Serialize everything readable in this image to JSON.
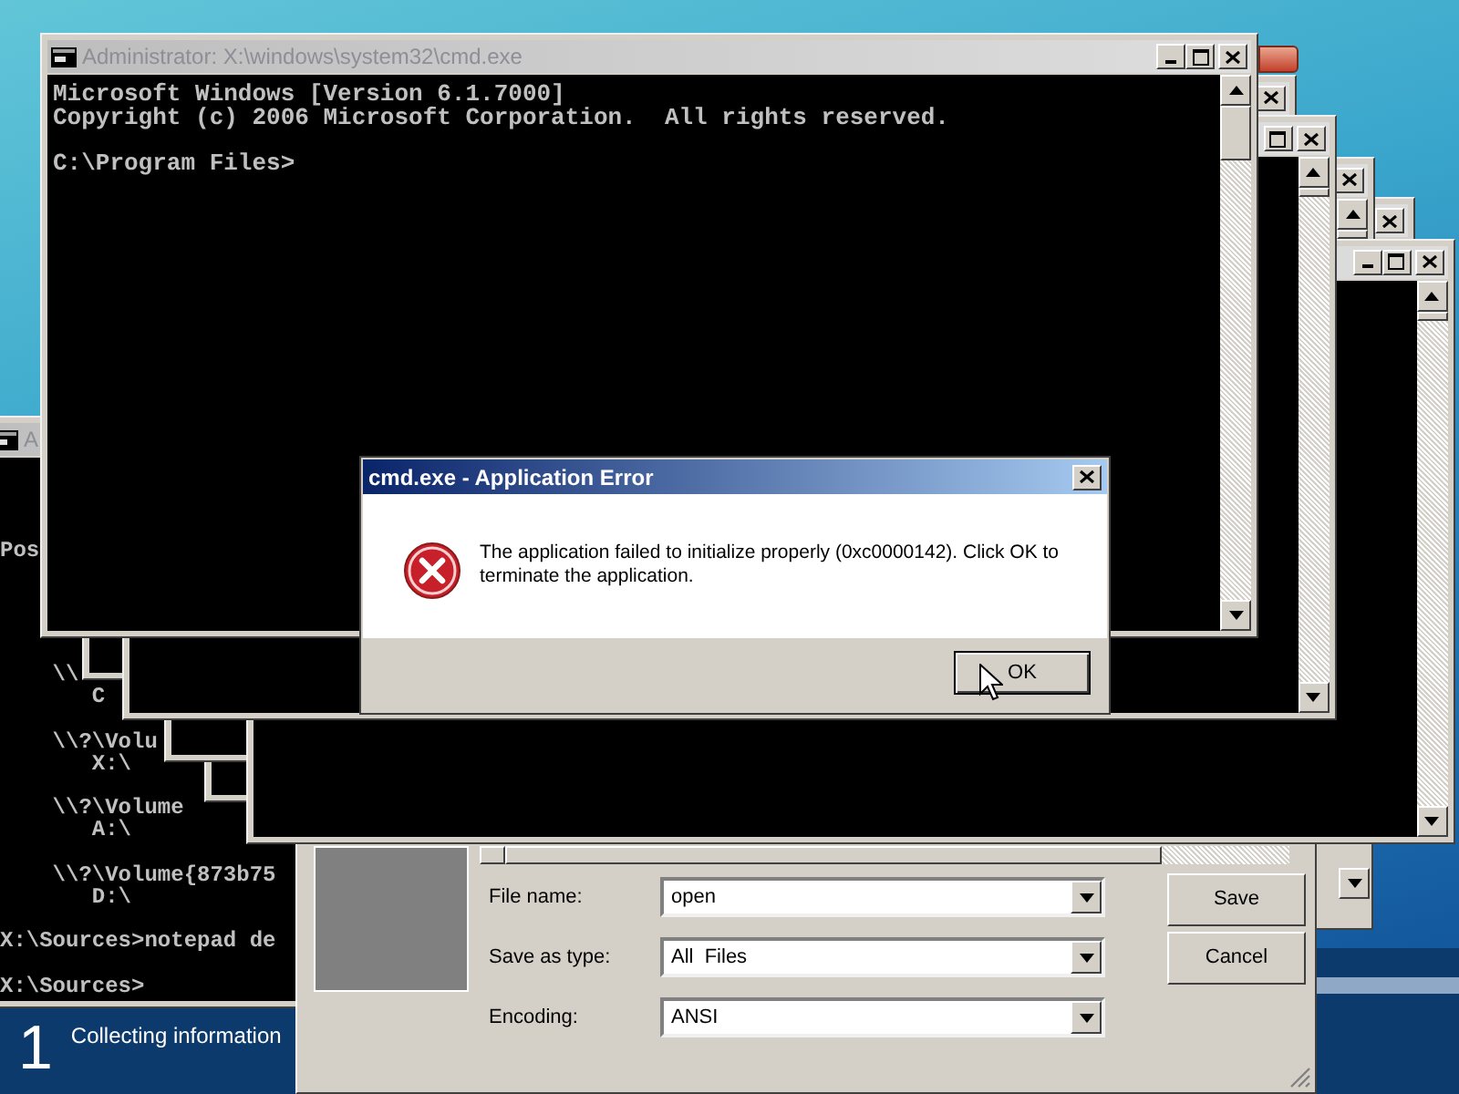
{
  "setup_bar": {
    "step": "1",
    "status": "Collecting information"
  },
  "left_console": {
    "title": "A",
    "top_lines": [
      {
        "text": "Pos"
      }
    ],
    "blocks": [
      [
        "    \\\\",
        "       C"
      ],
      [
        "    \\\\?\\Volu",
        "       X:\\"
      ],
      [
        "    \\\\?\\Volume",
        "       A:\\"
      ],
      [
        "    \\\\?\\Volume{873b75",
        "       D:\\"
      ],
      [
        "X:\\Sources>notepad de"
      ],
      [
        "X:\\Sources>"
      ]
    ]
  },
  "save_dialog": {
    "fields": [
      {
        "label": "File name:",
        "value": "open"
      },
      {
        "label": "Save as type:",
        "value": "All  Files"
      },
      {
        "label": "Encoding:",
        "value": "ANSI"
      }
    ],
    "buttons": [
      "Save",
      "Cancel"
    ]
  },
  "cascade_windows": [
    {
      "controls": [
        {
          "kind": "close"
        }
      ]
    },
    {
      "controls": [
        {
          "kind": "maximize"
        },
        {
          "kind": "close"
        }
      ],
      "scrollbar": true
    },
    {
      "controls": [
        {
          "kind": "close"
        }
      ],
      "scrollbar": true
    },
    {
      "controls": [
        {
          "kind": "close"
        }
      ]
    },
    {
      "controls": [
        {
          "kind": "minimize"
        },
        {
          "kind": "maximize"
        },
        {
          "kind": "close"
        }
      ],
      "scrollbar": true
    }
  ],
  "main_console": {
    "title": "Administrator: X:\\windows\\system32\\cmd.exe",
    "controls": [
      {
        "kind": "minimize"
      },
      {
        "kind": "maximize"
      },
      {
        "kind": "close"
      }
    ],
    "scrollbar": true,
    "blocks": [
      [
        "Microsoft Windows [Version 6.1.7000]",
        "Copyright (c) 2006 Microsoft Corporation.  All rights reserved."
      ],
      [
        "C:\\Program Files>"
      ]
    ]
  },
  "error_dialog": {
    "title": "cmd.exe - Application Error",
    "message": "The application failed to initialize properly (0xc0000142). Click OK to terminate the application.",
    "button": "OK"
  }
}
